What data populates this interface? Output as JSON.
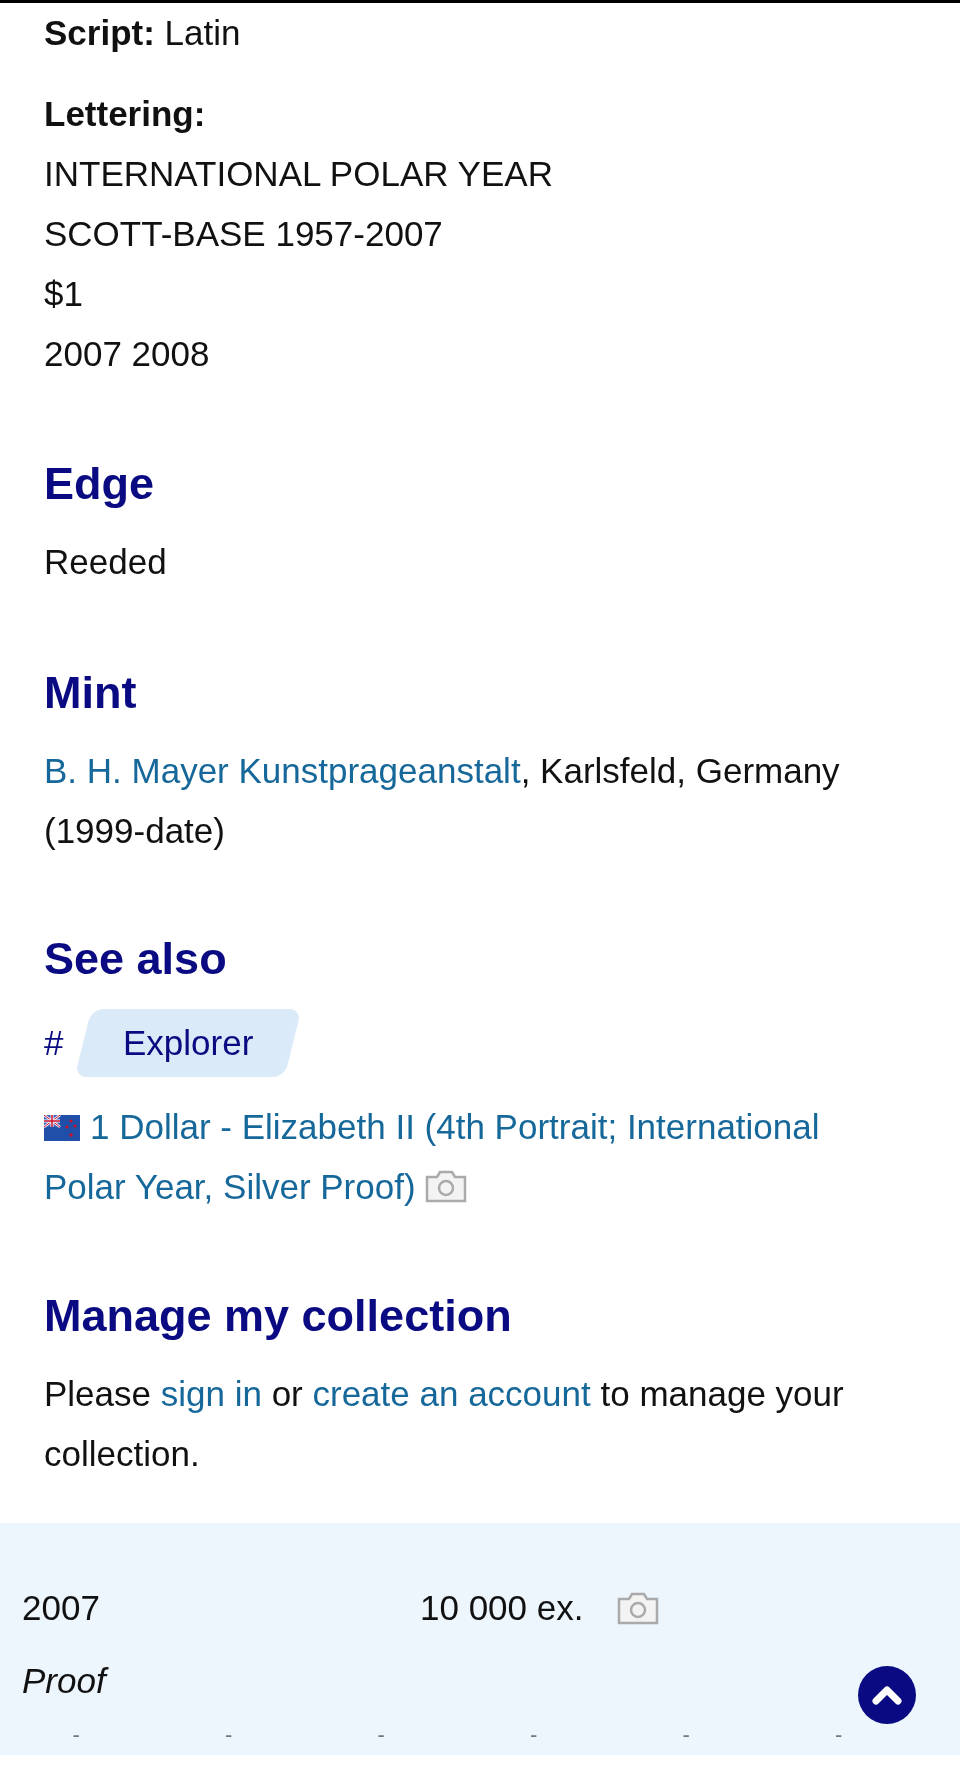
{
  "script": {
    "label": "Script:",
    "value": "Latin"
  },
  "lettering": {
    "label": "Lettering:",
    "lines": [
      "INTERNATIONAL POLAR YEAR",
      "SCOTT-BASE 1957-2007",
      "$1",
      "2007 2008"
    ]
  },
  "edge": {
    "heading": "Edge",
    "text": "Reeded"
  },
  "mint": {
    "heading": "Mint",
    "parts": [
      {
        "kind": "link",
        "text": "B. H. Mayer Kunstprageanstalt"
      },
      {
        "kind": "text",
        "text": ", Karlsfeld, Germany (1999-date)"
      }
    ]
  },
  "see_also": {
    "heading": "See also",
    "tag_mark": "#",
    "tags": [
      "Explorer"
    ],
    "related": [
      {
        "title": "1 Dollar - Elizabeth II (4th Portrait; International Polar Year, Silver Proof)",
        "has_photo": true
      }
    ]
  },
  "manage": {
    "heading": "Manage my collection",
    "parts": [
      {
        "kind": "text",
        "text": "Please "
      },
      {
        "kind": "link",
        "text": "sign in"
      },
      {
        "kind": "text",
        "text": " or "
      },
      {
        "kind": "link",
        "text": "create an account"
      },
      {
        "kind": "text",
        "text": " to manage your collection."
      }
    ]
  },
  "issues": [
    {
      "year": "2007",
      "mintage": "10 000 ex.",
      "has_photo": true,
      "variant": "Proof",
      "cells": [
        "-",
        "-",
        "-",
        "-",
        "-",
        "-"
      ]
    }
  ]
}
